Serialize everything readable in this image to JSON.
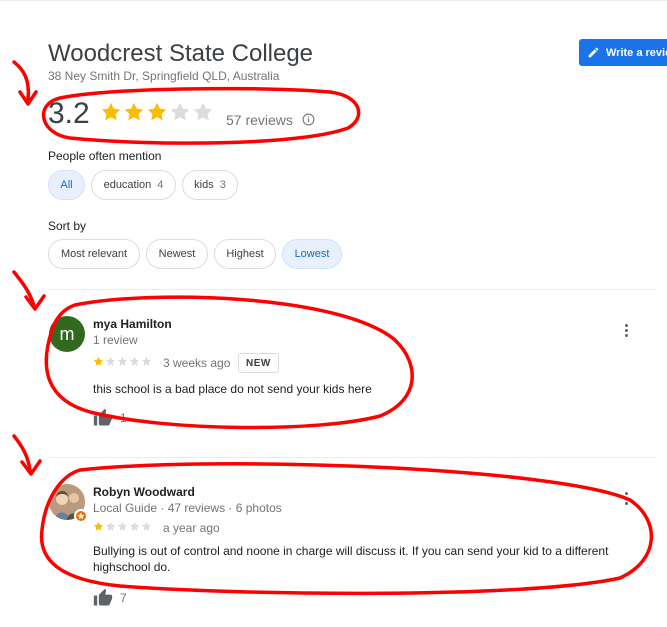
{
  "place": {
    "name": "Woodcrest State College",
    "address": "38 Ney Smith Dr, Springfield QLD, Australia",
    "rating": "3.2",
    "rating_value": 3.2,
    "reviews_count": "57 reviews"
  },
  "actions": {
    "write_review": "Write a revie"
  },
  "mentions": {
    "label": "People often mention",
    "chips": [
      {
        "label": "All",
        "count": ""
      },
      {
        "label": "education",
        "count": "4"
      },
      {
        "label": "kids",
        "count": "3"
      }
    ]
  },
  "sort": {
    "label": "Sort by",
    "options": [
      "Most relevant",
      "Newest",
      "Highest",
      "Lowest"
    ],
    "selected": "Lowest"
  },
  "reviews": [
    {
      "avatar_letter": "m",
      "avatar_color": "#33691e",
      "name": "mya Hamilton",
      "meta": "1 review",
      "stars": 1,
      "time": "3 weeks ago",
      "badge": "NEW",
      "text": "this school is a bad place do not send your kids here",
      "likes": "1"
    },
    {
      "avatar_icon": "profile-photo",
      "name": "Robyn Woodward",
      "meta": "Local Guide · 47 reviews · 6 photos",
      "stars": 1,
      "time": "a year ago",
      "text": "Bullying is out of control and noone in charge will discuss it. If you can send your kid to a different highschool do.",
      "likes": "7"
    }
  ],
  "colors": {
    "star_filled": "#fbbc04",
    "star_empty": "#dadce0",
    "accent": "#1a73e8",
    "annotation": "#ff0000"
  }
}
